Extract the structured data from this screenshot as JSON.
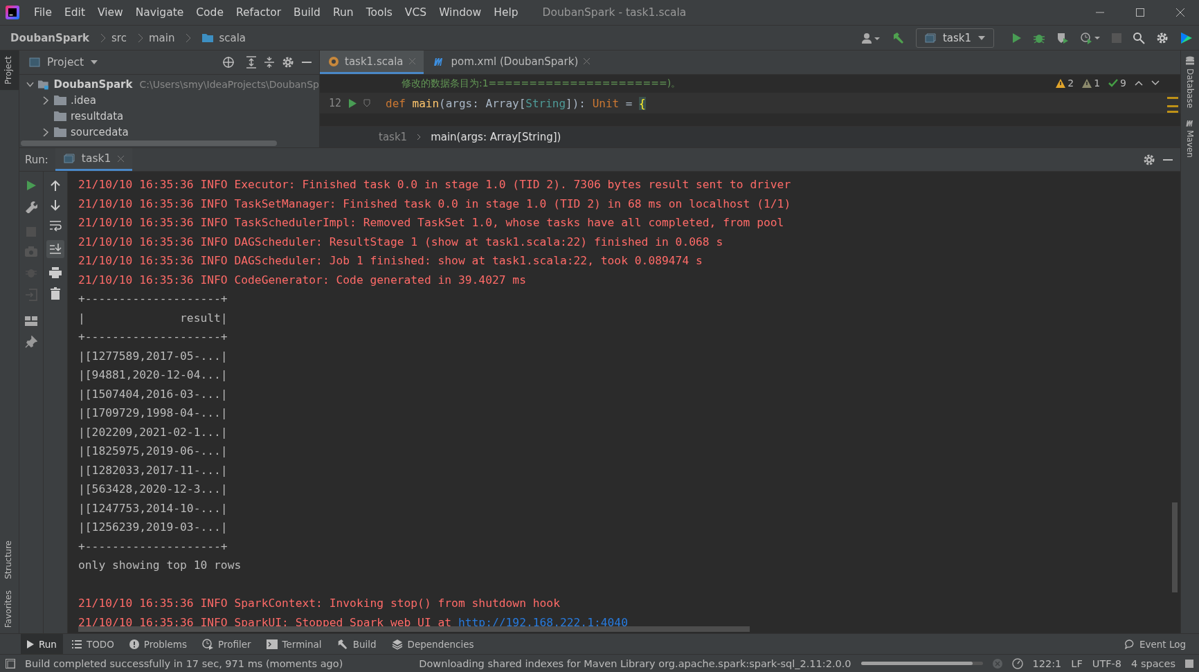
{
  "menu": [
    "File",
    "Edit",
    "View",
    "Navigate",
    "Code",
    "Refactor",
    "Build",
    "Run",
    "Tools",
    "VCS",
    "Window",
    "Help"
  ],
  "window": {
    "title": "DoubanSpark - task1.scala"
  },
  "breadcrumb": [
    "DoubanSpark",
    "src",
    "main",
    "scala"
  ],
  "run_config": "task1",
  "left_strip": {
    "top": [
      {
        "label": "Project",
        "selected": true
      }
    ],
    "bottom": [
      {
        "label": "Structure",
        "selected": false
      },
      {
        "label": "Favorites",
        "selected": false
      }
    ]
  },
  "right_strip": [
    "Database",
    "Maven"
  ],
  "project": {
    "title": "Project",
    "tree": [
      {
        "name": "DoubanSpark",
        "path": "C:\\Users\\smy\\IdeaProjects\\DoubanSp",
        "expanded": true,
        "children": [
          {
            "name": ".idea",
            "expanded": false
          },
          {
            "name": "resultdata"
          },
          {
            "name": "sourcedata",
            "expanded": false
          }
        ]
      }
    ]
  },
  "editor_tabs": [
    {
      "label": "task1.scala",
      "kind": "scala",
      "selected": true
    },
    {
      "label": "pom.xml (DoubanSpark)",
      "kind": "maven",
      "selected": false
    }
  ],
  "editor": {
    "comment": "修改的数据条目为:1======================)。",
    "line_number": "12",
    "code": [
      {
        "kind": "keyword",
        "text": "def "
      },
      {
        "kind": "function",
        "text": "main"
      },
      {
        "kind": "plain",
        "text": "(args: Array["
      },
      {
        "kind": "type",
        "text": "String"
      },
      {
        "kind": "plain",
        "text": "]): "
      },
      {
        "kind": "keyword",
        "text": "Unit"
      },
      {
        "kind": "plain",
        "text": " = "
      },
      {
        "kind": "brace",
        "text": "{"
      }
    ],
    "inspections": [
      {
        "kind": "warning",
        "count": "2"
      },
      {
        "kind": "weak",
        "count": "1"
      },
      {
        "kind": "typo",
        "count": "9"
      }
    ],
    "breadcrumb": [
      "task1",
      "main(args: Array[String])"
    ]
  },
  "run": {
    "label": "Run:",
    "tab": "task1",
    "lines": [
      {
        "kind": "log",
        "text": "21/10/10 16:35:36 INFO Executor: Finished task 0.0 in stage 1.0 (TID 2). 7306 bytes result sent to driver"
      },
      {
        "kind": "log",
        "text": "21/10/10 16:35:36 INFO TaskSetManager: Finished task 0.0 in stage 1.0 (TID 2) in 68 ms on localhost (1/1)"
      },
      {
        "kind": "log",
        "text": "21/10/10 16:35:36 INFO TaskSchedulerImpl: Removed TaskSet 1.0, whose tasks have all completed, from pool"
      },
      {
        "kind": "log",
        "text": "21/10/10 16:35:36 INFO DAGScheduler: ResultStage 1 (show at task1.scala:22) finished in 0.068 s"
      },
      {
        "kind": "log",
        "text": "21/10/10 16:35:36 INFO DAGScheduler: Job 1 finished: show at task1.scala:22, took 0.089474 s"
      },
      {
        "kind": "log",
        "text": "21/10/10 16:35:36 INFO CodeGenerator: Code generated in 39.4027 ms"
      },
      {
        "kind": "plain",
        "text": "+--------------------+"
      },
      {
        "kind": "plain",
        "text": "|              result|"
      },
      {
        "kind": "plain",
        "text": "+--------------------+"
      },
      {
        "kind": "plain",
        "text": "|[1277589,2017-05-...|"
      },
      {
        "kind": "plain",
        "text": "|[94881,2020-12-04...|"
      },
      {
        "kind": "plain",
        "text": "|[1507404,2016-03-...|"
      },
      {
        "kind": "plain",
        "text": "|[1709729,1998-04-...|"
      },
      {
        "kind": "plain",
        "text": "|[202209,2021-02-1...|"
      },
      {
        "kind": "plain",
        "text": "|[1825975,2019-06-...|"
      },
      {
        "kind": "plain",
        "text": "|[1282033,2017-11-...|"
      },
      {
        "kind": "plain",
        "text": "|[563428,2020-12-3...|"
      },
      {
        "kind": "plain",
        "text": "|[1247753,2014-10-...|"
      },
      {
        "kind": "plain",
        "text": "|[1256239,2019-03-...|"
      },
      {
        "kind": "plain",
        "text": "+--------------------+"
      },
      {
        "kind": "plain",
        "text": "only showing top 10 rows"
      },
      {
        "kind": "blank"
      },
      {
        "kind": "log",
        "text": "21/10/10 16:35:36 INFO SparkContext: Invoking stop() from shutdown hook"
      },
      {
        "kind": "log",
        "text": "21/10/10 16:35:36 INFO SparkUI: Stopped Spark web UI at ",
        "link": "http://192.168.222.1:4040"
      }
    ]
  },
  "bottom_tabs": [
    {
      "label": "Run",
      "kind": "run",
      "selected": true
    },
    {
      "label": "TODO",
      "kind": "todo",
      "selected": false
    },
    {
      "label": "Problems",
      "kind": "problems",
      "selected": false
    },
    {
      "label": "Profiler",
      "kind": "profiler",
      "selected": false
    },
    {
      "label": "Terminal",
      "kind": "terminal",
      "selected": false
    },
    {
      "label": "Build",
      "kind": "build",
      "selected": false
    },
    {
      "label": "Dependencies",
      "kind": "deps",
      "selected": false
    }
  ],
  "event_log": "Event Log",
  "status_bar": {
    "message": "Build completed successfully in 17 sec, 971 ms (moments ago)",
    "progress_text": "Downloading shared indexes for Maven Library org.apache.spark:spark-sql_2.11:2.0.0",
    "level": 0.92,
    "position": "122:1",
    "line_sep": "LF",
    "encoding": "UTF-8",
    "indent": "4 spaces"
  }
}
